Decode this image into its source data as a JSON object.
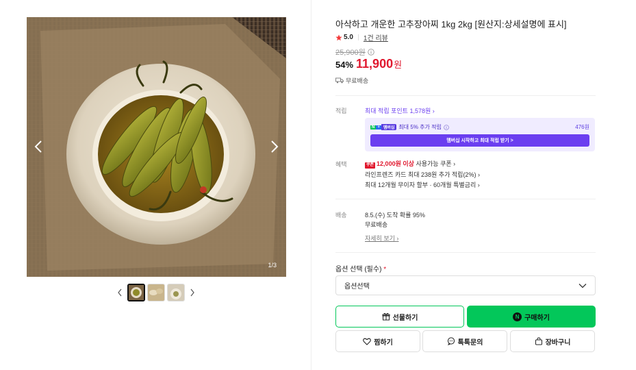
{
  "gallery": {
    "counter": "1/3",
    "prev_label": "이전",
    "next_label": "다음"
  },
  "product": {
    "title": "아삭하고 개운한 고추장아찌 1kg 2kg [원산지:상세설명에 표시]",
    "rating": "5.0",
    "review_link": "1건 리뷰",
    "original_price": "25,900원",
    "discount_rate": "54%",
    "sale_price": "11,900",
    "won": "원",
    "shipping_badge": "무료배송"
  },
  "points": {
    "label": "적립",
    "max_points": "최대 적립 포인트 1,578원",
    "member_extra": "최대 5% 추가 적립",
    "member_amount": "476원",
    "member_badge_n": "N",
    "member_badge_plus": "+",
    "member_badge_m": "멤버십",
    "member_button": "멤버십 시작하고 최대 적립 받기 >"
  },
  "benefits": {
    "label": "혜택",
    "coupon_amount": "12,000원 이상",
    "coupon_rest": "사용가능 쿠폰",
    "card_tag": "쿠폰",
    "card_line": "라인프렌즈 카드 최대 238원 추가 적립(2%)",
    "installment": "최대 12개월 무이자 할부 · 60개월 특별금리"
  },
  "delivery": {
    "label": "배송",
    "arrival": "8.5.(수) 도착 확률 95%",
    "free": "무료배송",
    "detail_link": "자세히 보기"
  },
  "option": {
    "label": "옵션 선택 (필수)",
    "required_mark": "*",
    "select_value": "옵션선택"
  },
  "actions": {
    "gift": "선물하기",
    "buy": "구매하기",
    "buy_n": "N",
    "zzim": "찜하기",
    "talk": "톡톡문의",
    "cart": "장바구니"
  },
  "colors": {
    "accent_green": "#03c75a",
    "price_red": "#e0182e",
    "purple": "#6b3ef0"
  }
}
